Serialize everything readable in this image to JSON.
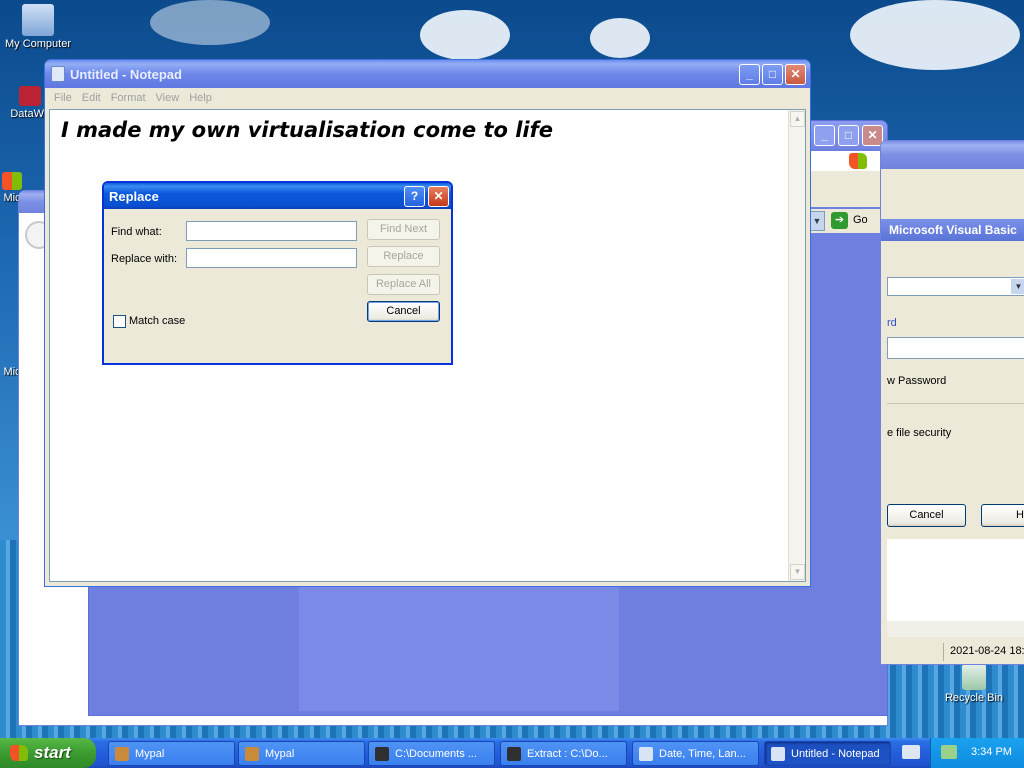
{
  "desktop": {
    "icons": {
      "my_computer": "My Computer",
      "datawa": "DataWa",
      "mic1": "Mic",
      "mic2": "Mic",
      "recycle_bin": "Recycle Bin"
    }
  },
  "notepad": {
    "title": "Untitled - Notepad",
    "menu": [
      "File",
      "Edit",
      "Format",
      "View",
      "Help"
    ],
    "content": "I made my own virtualisation come to life"
  },
  "replace_dialog": {
    "title": "Replace",
    "help_button": "?",
    "find_label": "Find what:",
    "replace_label": "Replace with:",
    "find_value": "",
    "replace_value": "",
    "find_next": "Find Next",
    "replace": "Replace",
    "replace_all": "Replace All",
    "cancel": "Cancel",
    "match_case": "Match case"
  },
  "ie_window": {
    "go_label": "Go"
  },
  "vb_window": {
    "title": "Microsoft Visual Basic",
    "link_fragment": "rd",
    "password_fragment": "w Password",
    "security_fragment": "e file security",
    "cancel": "Cancel",
    "help_fragment": "H",
    "timestamp": "2021-08-24 18:"
  },
  "taskbar": {
    "start": "start",
    "tasks": [
      {
        "label": "Mypal",
        "icon_color": "#c98a3a"
      },
      {
        "label": "Mypal",
        "icon_color": "#c98a3a"
      },
      {
        "label": "C:\\Documents ...",
        "icon_color": "#303030"
      },
      {
        "label": "Extract : C:\\Do...",
        "icon_color": "#303030"
      },
      {
        "label": "Date, Time, Lan...",
        "icon_color": "#d8e4f4"
      },
      {
        "label": "Untitled - Notepad",
        "icon_color": "#d8e4f4"
      }
    ],
    "clock": "3:34 PM"
  },
  "colors": {
    "title_active": "#0a58dc",
    "title_inactive": "#7b8fe4",
    "dialog_face": "#ece9d8",
    "taskbar": "#245edb",
    "start_green": "#3d9e33"
  }
}
